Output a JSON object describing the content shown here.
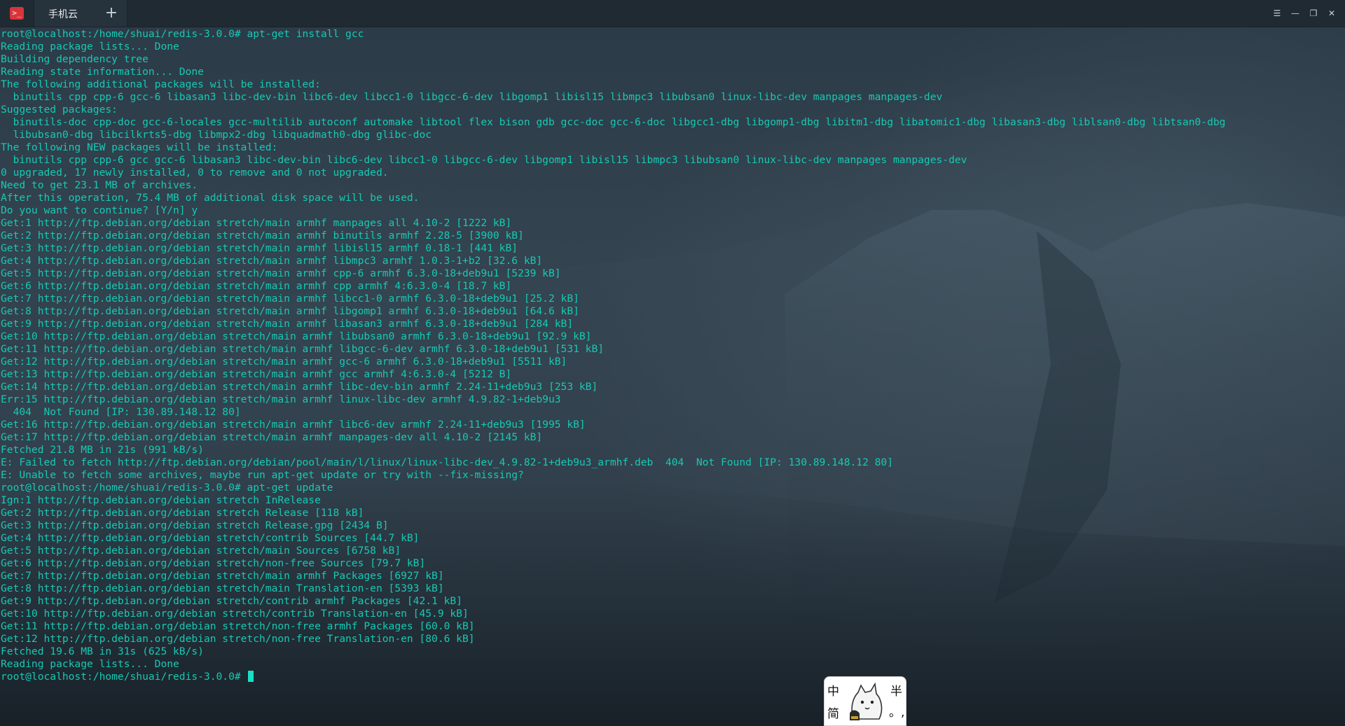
{
  "window": {
    "tab_title": "手机云",
    "new_tab_symbol": "+",
    "controls": {
      "menu": "☰",
      "minimize": "—",
      "maximize": "❐",
      "close": "✕"
    }
  },
  "terminal": {
    "lines": [
      "root@localhost:/home/shuai/redis-3.0.0# apt-get install gcc",
      "Reading package lists... Done",
      "Building dependency tree",
      "Reading state information... Done",
      "The following additional packages will be installed:",
      "  binutils cpp cpp-6 gcc-6 libasan3 libc-dev-bin libc6-dev libcc1-0 libgcc-6-dev libgomp1 libisl15 libmpc3 libubsan0 linux-libc-dev manpages manpages-dev",
      "Suggested packages:",
      "  binutils-doc cpp-doc gcc-6-locales gcc-multilib autoconf automake libtool flex bison gdb gcc-doc gcc-6-doc libgcc1-dbg libgomp1-dbg libitm1-dbg libatomic1-dbg libasan3-dbg liblsan0-dbg libtsan0-dbg",
      "  libubsan0-dbg libcilkrts5-dbg libmpx2-dbg libquadmath0-dbg glibc-doc",
      "The following NEW packages will be installed:",
      "  binutils cpp cpp-6 gcc gcc-6 libasan3 libc-dev-bin libc6-dev libcc1-0 libgcc-6-dev libgomp1 libisl15 libmpc3 libubsan0 linux-libc-dev manpages manpages-dev",
      "0 upgraded, 17 newly installed, 0 to remove and 0 not upgraded.",
      "Need to get 23.1 MB of archives.",
      "After this operation, 75.4 MB of additional disk space will be used.",
      "Do you want to continue? [Y/n] y",
      "Get:1 http://ftp.debian.org/debian stretch/main armhf manpages all 4.10-2 [1222 kB]",
      "Get:2 http://ftp.debian.org/debian stretch/main armhf binutils armhf 2.28-5 [3900 kB]",
      "Get:3 http://ftp.debian.org/debian stretch/main armhf libisl15 armhf 0.18-1 [441 kB]",
      "Get:4 http://ftp.debian.org/debian stretch/main armhf libmpc3 armhf 1.0.3-1+b2 [32.6 kB]",
      "Get:5 http://ftp.debian.org/debian stretch/main armhf cpp-6 armhf 6.3.0-18+deb9u1 [5239 kB]",
      "Get:6 http://ftp.debian.org/debian stretch/main armhf cpp armhf 4:6.3.0-4 [18.7 kB]",
      "Get:7 http://ftp.debian.org/debian stretch/main armhf libcc1-0 armhf 6.3.0-18+deb9u1 [25.2 kB]",
      "Get:8 http://ftp.debian.org/debian stretch/main armhf libgomp1 armhf 6.3.0-18+deb9u1 [64.6 kB]",
      "Get:9 http://ftp.debian.org/debian stretch/main armhf libasan3 armhf 6.3.0-18+deb9u1 [284 kB]",
      "Get:10 http://ftp.debian.org/debian stretch/main armhf libubsan0 armhf 6.3.0-18+deb9u1 [92.9 kB]",
      "Get:11 http://ftp.debian.org/debian stretch/main armhf libgcc-6-dev armhf 6.3.0-18+deb9u1 [531 kB]",
      "Get:12 http://ftp.debian.org/debian stretch/main armhf gcc-6 armhf 6.3.0-18+deb9u1 [5511 kB]",
      "Get:13 http://ftp.debian.org/debian stretch/main armhf gcc armhf 4:6.3.0-4 [5212 B]",
      "Get:14 http://ftp.debian.org/debian stretch/main armhf libc-dev-bin armhf 2.24-11+deb9u3 [253 kB]",
      "Err:15 http://ftp.debian.org/debian stretch/main armhf linux-libc-dev armhf 4.9.82-1+deb9u3",
      "  404  Not Found [IP: 130.89.148.12 80]",
      "Get:16 http://ftp.debian.org/debian stretch/main armhf libc6-dev armhf 2.24-11+deb9u3 [1995 kB]",
      "Get:17 http://ftp.debian.org/debian stretch/main armhf manpages-dev all 4.10-2 [2145 kB]",
      "Fetched 21.8 MB in 21s (991 kB/s)",
      "E: Failed to fetch http://ftp.debian.org/debian/pool/main/l/linux/linux-libc-dev_4.9.82-1+deb9u3_armhf.deb  404  Not Found [IP: 130.89.148.12 80]",
      "E: Unable to fetch some archives, maybe run apt-get update or try with --fix-missing?",
      "root@localhost:/home/shuai/redis-3.0.0# apt-get update",
      "Ign:1 http://ftp.debian.org/debian stretch InRelease",
      "Get:2 http://ftp.debian.org/debian stretch Release [118 kB]",
      "Get:3 http://ftp.debian.org/debian stretch Release.gpg [2434 B]",
      "Get:4 http://ftp.debian.org/debian stretch/contrib Sources [44.7 kB]",
      "Get:5 http://ftp.debian.org/debian stretch/main Sources [6758 kB]",
      "Get:6 http://ftp.debian.org/debian stretch/non-free Sources [79.7 kB]",
      "Get:7 http://ftp.debian.org/debian stretch/main armhf Packages [6927 kB]",
      "Get:8 http://ftp.debian.org/debian stretch/main Translation-en [5393 kB]",
      "Get:9 http://ftp.debian.org/debian stretch/contrib armhf Packages [42.1 kB]",
      "Get:10 http://ftp.debian.org/debian stretch/contrib Translation-en [45.9 kB]",
      "Get:11 http://ftp.debian.org/debian stretch/non-free armhf Packages [60.0 kB]",
      "Get:12 http://ftp.debian.org/debian stretch/non-free Translation-en [80.6 kB]",
      "Fetched 19.6 MB in 31s (625 kB/s)",
      "Reading package lists... Done"
    ],
    "prompt": "root@localhost:/home/shuai/redis-3.0.0# "
  },
  "ime": {
    "top_left": "中",
    "bottom_left": "简",
    "top_right": "半",
    "bottom_right": "。,"
  },
  "colors": {
    "terminal_text": "#17c9b4",
    "titlebar": "#1f2a33",
    "app_icon": "#d9343b"
  }
}
